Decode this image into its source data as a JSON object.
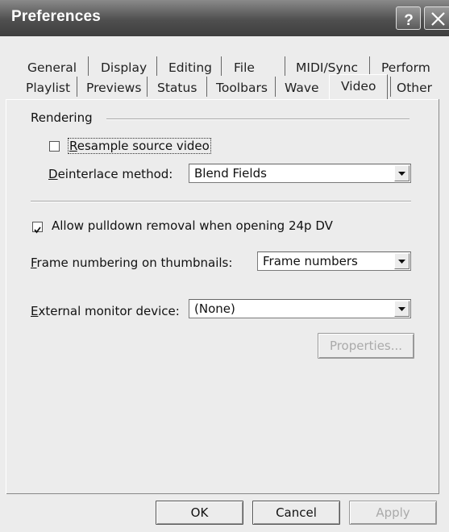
{
  "window": {
    "title": "Preferences"
  },
  "tabs": {
    "row1": [
      "General",
      "Display",
      "Editing",
      "File",
      "MIDI/Sync",
      "Perform"
    ],
    "row2": [
      "Playlist",
      "Previews",
      "Status",
      "Toolbars",
      "Wave",
      "Video",
      "Other"
    ],
    "active": "Video"
  },
  "rendering": {
    "group_label": "Rendering",
    "resample": {
      "label_first": "R",
      "label_rest": "esample source video",
      "checked": false
    },
    "deinterlace": {
      "label_first": "D",
      "label_rest": "einterlace method:",
      "value": "Blend Fields"
    }
  },
  "pulldown": {
    "label": "Allow pulldown removal when opening 24p DV",
    "checked": true
  },
  "frame_numbering": {
    "label_first": "F",
    "label_rest": "rame numbering on thumbnails:",
    "value": "Frame numbers"
  },
  "external_monitor": {
    "label_first": "E",
    "label_rest": "xternal monitor device:",
    "value": "(None)"
  },
  "buttons": {
    "properties": "Properties...",
    "ok": "OK",
    "cancel": "Cancel",
    "apply": "Apply"
  }
}
